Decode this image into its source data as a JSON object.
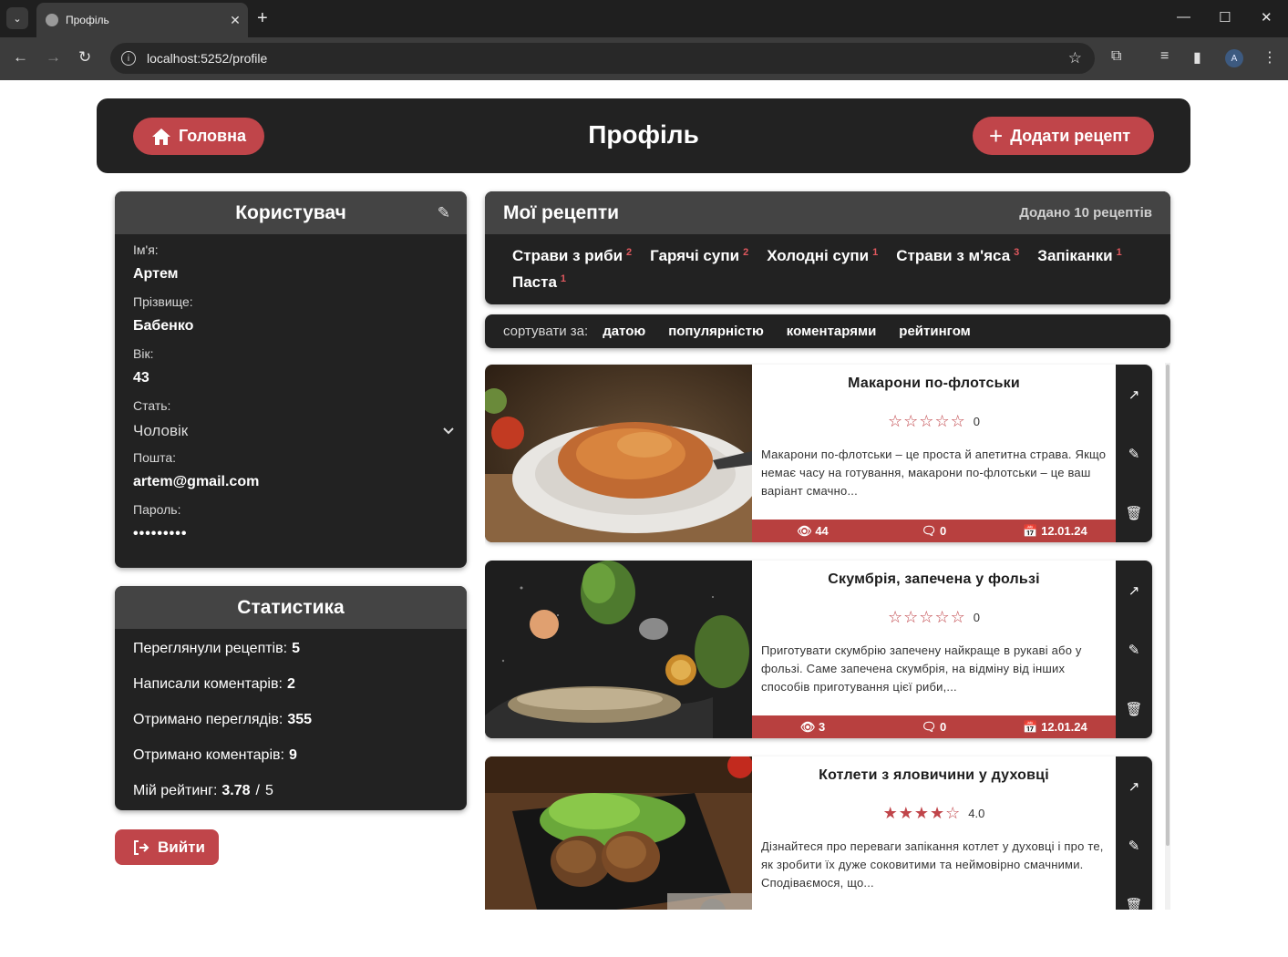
{
  "browser": {
    "tab_title": "Профіль",
    "url": "localhost:5252/profile",
    "profile_initial": "A"
  },
  "header": {
    "home_label": "Головна",
    "title": "Профіль",
    "add_label": "Додати рецепт"
  },
  "user": {
    "title": "Користувач",
    "fields": [
      {
        "label": "Ім'я:",
        "value": "Артем"
      },
      {
        "label": "Прізвище:",
        "value": "Бабенко"
      },
      {
        "label": "Вік:",
        "value": "43"
      }
    ],
    "gender_label": "Стать:",
    "gender_value": "Чоловік",
    "email_label": "Пошта:",
    "email_value": "artem@gmail.com",
    "password_label": "Пароль:",
    "password_value": "•••••••••"
  },
  "stats": {
    "title": "Статистика",
    "items": [
      {
        "label": "Переглянули рецептів:",
        "value": "5"
      },
      {
        "label": "Написали коментарів:",
        "value": "2"
      },
      {
        "label": "Отримано переглядів:",
        "value": "355"
      },
      {
        "label": "Отримано коментарів:",
        "value": "9"
      }
    ],
    "rating_label": "Мій рейтинг:",
    "rating_value": "3.78",
    "rating_sep": "/",
    "rating_max": "5"
  },
  "logout_label": "Вийти",
  "recipes": {
    "title": "Мої рецепти",
    "count_text": "Додано 10 рецептів",
    "categories": [
      {
        "name": "Страви з риби",
        "count": "2"
      },
      {
        "name": "Гарячі супи",
        "count": "2"
      },
      {
        "name": "Холодні супи",
        "count": "1"
      },
      {
        "name": "Страви з м'яса",
        "count": "3"
      },
      {
        "name": "Запіканки",
        "count": "1"
      },
      {
        "name": "Паста",
        "count": "1"
      }
    ]
  },
  "sort": {
    "label": "сортувати за:",
    "options": [
      "датою",
      "популярністю",
      "коментарями",
      "рейтингом"
    ]
  },
  "recipe_items": [
    {
      "title": "Макарони по-флотськи",
      "rating": 0,
      "rating_text": "0",
      "description": "Макарони по-флотськи – це проста й апетитна страва. Якщо немає часу на готування, макарони по-флотськи – це ваш варіант смачно...",
      "views": "44",
      "comments": "0",
      "date": "12.01.24"
    },
    {
      "title": "Скумбрія, запечена у фользі",
      "rating": 0,
      "rating_text": "0",
      "description": "Приготувати скумбрію запечену найкраще в рукаві або у фользі. Саме запечена скумбрія, на відміну від інших способів приготування цієї риби,...",
      "views": "3",
      "comments": "0",
      "date": "12.01.24"
    },
    {
      "title": "Котлети з яловичини у духовці",
      "rating": 4,
      "rating_text": "4.0",
      "description": "Дізнайтеся про переваги запікання котлет у духовці і про те, як зробити їх дуже соковитими та неймовірно смачними. Сподіваємося, що...",
      "views": "",
      "comments": "",
      "date": ""
    }
  ],
  "colors": {
    "accent": "#c0454a",
    "card": "#222222",
    "card_header": "#444444"
  }
}
